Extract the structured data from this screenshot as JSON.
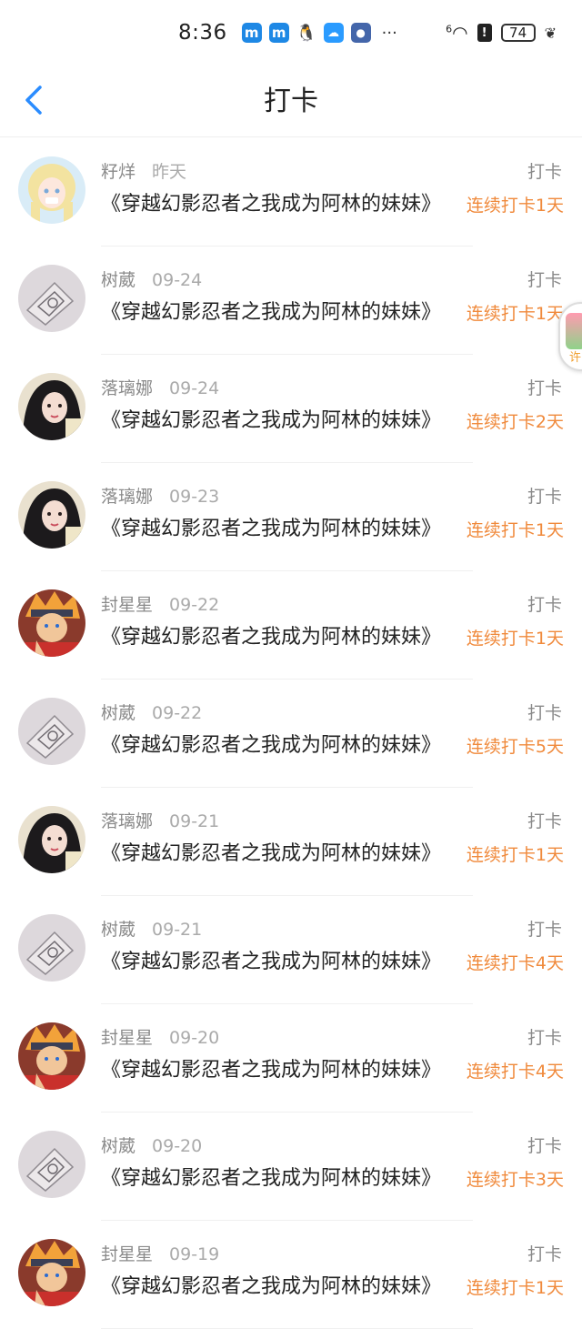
{
  "status_bar": {
    "time": "8:36",
    "app_icons": [
      "m-app-icon",
      "m-app-icon",
      "qq-icon",
      "cloud-icon",
      "game-icon"
    ],
    "more": "···",
    "signal": "6",
    "battery": "74"
  },
  "header": {
    "title": "打卡"
  },
  "floating": {
    "label": "许"
  },
  "entries": [
    {
      "name": "籽烊",
      "date": "昨天",
      "tag": "打卡",
      "content": "《穿越幻影忍者之我成为阿林的妹妹》",
      "streak": "连续打卡1天",
      "avatar": "anime-girl"
    },
    {
      "name": "树葳",
      "date": "09-24",
      "tag": "打卡",
      "content": "《穿越幻影忍者之我成为阿林的妹妹》",
      "streak": "连续打卡1天",
      "avatar": "sketch"
    },
    {
      "name": "落璃娜",
      "date": "09-24",
      "tag": "打卡",
      "content": "《穿越幻影忍者之我成为阿林的妹妹》",
      "streak": "连续打卡2天",
      "avatar": "dark-hair"
    },
    {
      "name": "落璃娜",
      "date": "09-23",
      "tag": "打卡",
      "content": "《穿越幻影忍者之我成为阿林的妹妹》",
      "streak": "连续打卡1天",
      "avatar": "dark-hair"
    },
    {
      "name": "封星星",
      "date": "09-22",
      "tag": "打卡",
      "content": "《穿越幻影忍者之我成为阿林的妹妹》",
      "streak": "连续打卡1天",
      "avatar": "ninja"
    },
    {
      "name": "树葳",
      "date": "09-22",
      "tag": "打卡",
      "content": "《穿越幻影忍者之我成为阿林的妹妹》",
      "streak": "连续打卡5天",
      "avatar": "sketch"
    },
    {
      "name": "落璃娜",
      "date": "09-21",
      "tag": "打卡",
      "content": "《穿越幻影忍者之我成为阿林的妹妹》",
      "streak": "连续打卡1天",
      "avatar": "dark-hair"
    },
    {
      "name": "树葳",
      "date": "09-21",
      "tag": "打卡",
      "content": "《穿越幻影忍者之我成为阿林的妹妹》",
      "streak": "连续打卡4天",
      "avatar": "sketch"
    },
    {
      "name": "封星星",
      "date": "09-20",
      "tag": "打卡",
      "content": "《穿越幻影忍者之我成为阿林的妹妹》",
      "streak": "连续打卡4天",
      "avatar": "ninja"
    },
    {
      "name": "树葳",
      "date": "09-20",
      "tag": "打卡",
      "content": "《穿越幻影忍者之我成为阿林的妹妹》",
      "streak": "连续打卡3天",
      "avatar": "sketch"
    },
    {
      "name": "封星星",
      "date": "09-19",
      "tag": "打卡",
      "content": "《穿越幻影忍者之我成为阿林的妹妹》",
      "streak": "连续打卡1天",
      "avatar": "ninja"
    }
  ]
}
